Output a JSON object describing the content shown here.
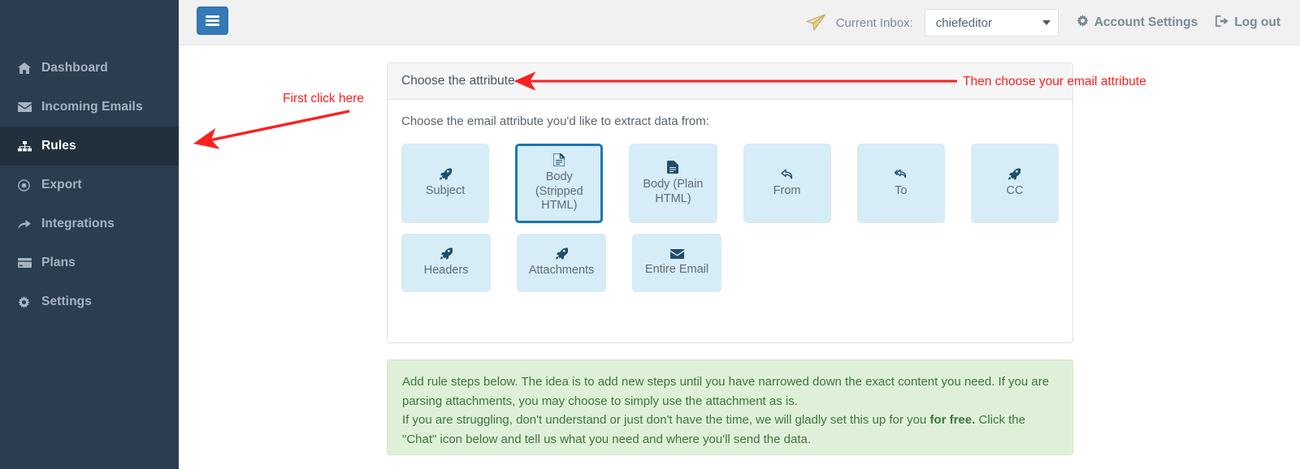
{
  "sidebar": {
    "items": [
      {
        "label": "Dashboard",
        "icon": "home-icon",
        "active": false
      },
      {
        "label": "Incoming Emails",
        "icon": "envelope-icon",
        "active": false
      },
      {
        "label": "Rules",
        "icon": "sitemap-icon",
        "active": true
      },
      {
        "label": "Export",
        "icon": "dot-circle-icon",
        "active": false
      },
      {
        "label": "Integrations",
        "icon": "share-arrow-icon",
        "active": false
      },
      {
        "label": "Plans",
        "icon": "credit-card-icon",
        "active": false
      },
      {
        "label": "Settings",
        "icon": "gear-icon",
        "active": false
      }
    ]
  },
  "topbar": {
    "menu_toggle": "hamburger-icon",
    "plane_icon": "paper-plane-icon",
    "inbox_label": "Current Inbox:",
    "inbox_value": "chiefeditor",
    "inbox_options": [
      "chiefeditor"
    ],
    "account_settings": "Account Settings",
    "logout": "Log out"
  },
  "panel": {
    "header": "Choose the attribute",
    "lede": "Choose the email attribute you'd like to extract data from:",
    "tiles_row1": [
      {
        "label": "Subject",
        "icon": "rocket-icon",
        "selected": false
      },
      {
        "label": "Body\n(Stripped\nHTML)",
        "icon": "file-icon",
        "selected": true
      },
      {
        "label": "Body (Plain\nHTML)",
        "icon": "file-alt-icon",
        "selected": false
      },
      {
        "label": "From",
        "icon": "reply-icon",
        "selected": false
      },
      {
        "label": "To",
        "icon": "reply-all-icon",
        "selected": false
      },
      {
        "label": "CC",
        "icon": "rocket-icon",
        "selected": false
      }
    ],
    "tiles_row2": [
      {
        "label": "Headers",
        "icon": "rocket-icon",
        "selected": false
      },
      {
        "label": "Attachments",
        "icon": "rocket-icon",
        "selected": false
      },
      {
        "label": "Entire Email",
        "icon": "envelope-icon",
        "selected": false
      }
    ]
  },
  "alert": {
    "line1": "Add rule steps below. The idea is to add new steps until you have narrowed down the exact content you need. If you are parsing attachments, you may choose to simply use the attachment as is.",
    "line2_a": "If you are struggling, don't understand or just don't have the time, we will gladly set this up for you ",
    "line2_bold": "for free.",
    "line2_b": " Click the \"Chat\" icon below and tell us what you need and where you'll send the data."
  },
  "annotations": {
    "first": "First click here",
    "second": "Then choose your email attribute",
    "color": "#fc2020"
  },
  "colors": {
    "sidebar_bg": "#2b3e50",
    "sidebar_active_bg": "#22303d",
    "topbar_bg": "#f1f1f2",
    "accent_blue": "#1b77b3",
    "tile_bg": "#d6ecf7",
    "alert_bg": "#dff0d8",
    "alert_text": "#3c763d",
    "plane_gold": "#f0d98c"
  }
}
